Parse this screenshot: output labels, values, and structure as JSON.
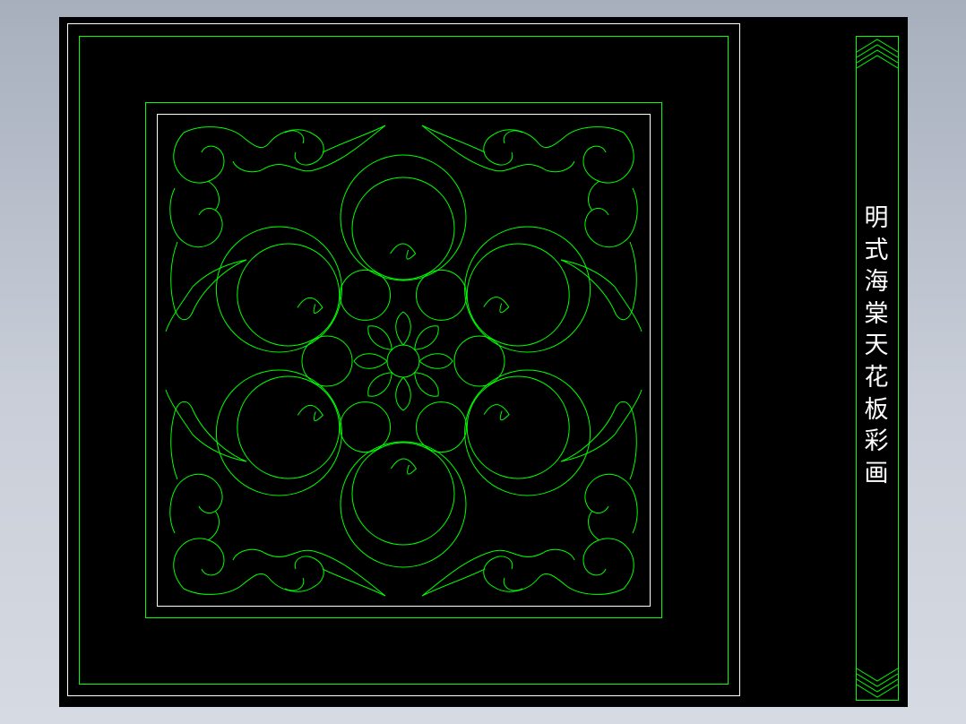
{
  "drawing": {
    "title": "明式海棠天花板彩画",
    "colors": {
      "background": "#000000",
      "frame": "#ffffff",
      "ornament": "#00ff00",
      "viewport_surround": "#c4c9d3"
    }
  }
}
